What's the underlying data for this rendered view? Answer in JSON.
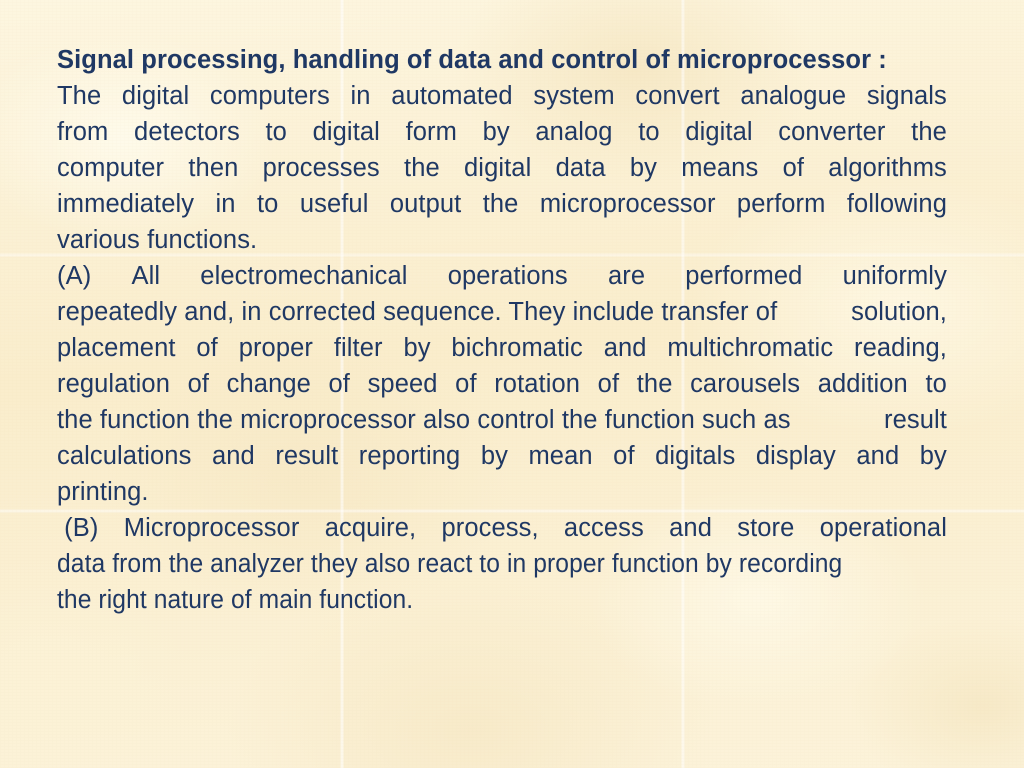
{
  "slide": {
    "background_color": "#fbf0d2",
    "text_color": "#1f3864",
    "heading": "Signal processing, handling of data and control of microprocessor :",
    "lines": [
      {
        "id": "l1",
        "style": "justify",
        "words": [
          "The",
          "digital",
          "computers",
          "in",
          "automated",
          "system",
          "convert",
          "analogue",
          "signals"
        ]
      },
      {
        "id": "l2",
        "style": "justify",
        "words": [
          "from",
          "detectors",
          "to",
          "digital",
          "form",
          "by",
          "analog",
          "to",
          "digital",
          "converter",
          "the"
        ]
      },
      {
        "id": "l3",
        "style": "justify",
        "words": [
          "computer",
          "then",
          "processes",
          "the",
          "digital",
          "data",
          "by",
          "means",
          "of",
          "algorithms"
        ]
      },
      {
        "id": "l4",
        "style": "justify",
        "words": [
          "immediately",
          "in",
          "to",
          "useful",
          "output",
          "the",
          "microprocessor",
          "perform",
          "following"
        ]
      },
      {
        "id": "l5",
        "style": "left",
        "text": "various functions."
      },
      {
        "id": "l6",
        "style": "justify",
        "words": [
          "(A)",
          "All",
          "electromechanical",
          "operations",
          "are",
          "performed",
          "uniformly"
        ]
      },
      {
        "id": "l7",
        "style": "justify",
        "words": [
          "repeatedly and, in corrected sequence. They include transfer of",
          "solution,"
        ]
      },
      {
        "id": "l8",
        "style": "justify",
        "words": [
          "placement",
          "of",
          "proper",
          "filter",
          "by",
          "bichromatic",
          "and",
          "multichromatic",
          "reading,"
        ]
      },
      {
        "id": "l9",
        "style": "justify",
        "words": [
          "regulation",
          "of",
          "change",
          "of",
          "speed",
          "of",
          "rotation",
          "of",
          "the",
          "carousels",
          "addition",
          "to"
        ]
      },
      {
        "id": "l10",
        "style": "justify",
        "words": [
          "the function the microprocessor also control the function such as",
          "result"
        ]
      },
      {
        "id": "l11",
        "style": "justify",
        "words": [
          "calculations",
          "and",
          "result",
          "reporting",
          "by",
          "mean",
          "of",
          "digitals",
          "display",
          "and",
          "by"
        ]
      },
      {
        "id": "l12",
        "style": "left",
        "text": "printing."
      },
      {
        "id": "l13",
        "style": "justify",
        "words": [
          " (B)",
          "Microprocessor",
          "acquire,",
          "process,",
          "access",
          "and",
          "store",
          "operational"
        ]
      },
      {
        "id": "l14",
        "style": "left-condensed",
        "text": "data from the analyzer they also react to in proper function by recording"
      },
      {
        "id": "l15",
        "style": "left-condensed",
        "text": "the right nature of main function."
      }
    ]
  }
}
